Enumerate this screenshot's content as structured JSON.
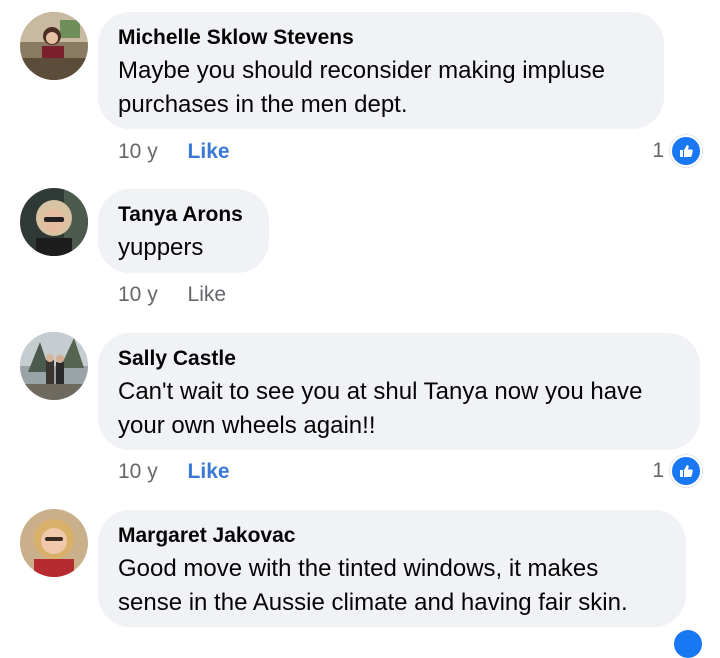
{
  "comments": [
    {
      "author": "Michelle Sklow Stevens",
      "text": "Maybe you should reconsider making impluse purchases in the men dept.",
      "time": "10 y",
      "like_label": "Like",
      "reaction_count": "1",
      "avatar_icon": "profile-photo"
    },
    {
      "author": "Tanya Arons",
      "text": "yuppers",
      "time": "10 y",
      "like_label": "Like",
      "reaction_count": "",
      "avatar_icon": "profile-photo"
    },
    {
      "author": "Sally Castle",
      "text": "Can't wait to see you at shul Tanya now you have your own wheels again!!",
      "time": "10 y",
      "like_label": "Like",
      "reaction_count": "1",
      "avatar_icon": "profile-photo"
    },
    {
      "author": "Margaret Jakovac",
      "text": "Good move with the tinted windows, it makes sense in the Aussie climate and having fair skin.",
      "time": "",
      "like_label": "",
      "reaction_count": "",
      "avatar_icon": "profile-photo"
    }
  ],
  "colors": {
    "bubble": "#f0f2f5",
    "like_active": "#3b79d6",
    "reaction_badge": "#1877f2",
    "meta_text": "#65676b"
  },
  "icons": {
    "reaction": "thumbs-up-icon"
  }
}
